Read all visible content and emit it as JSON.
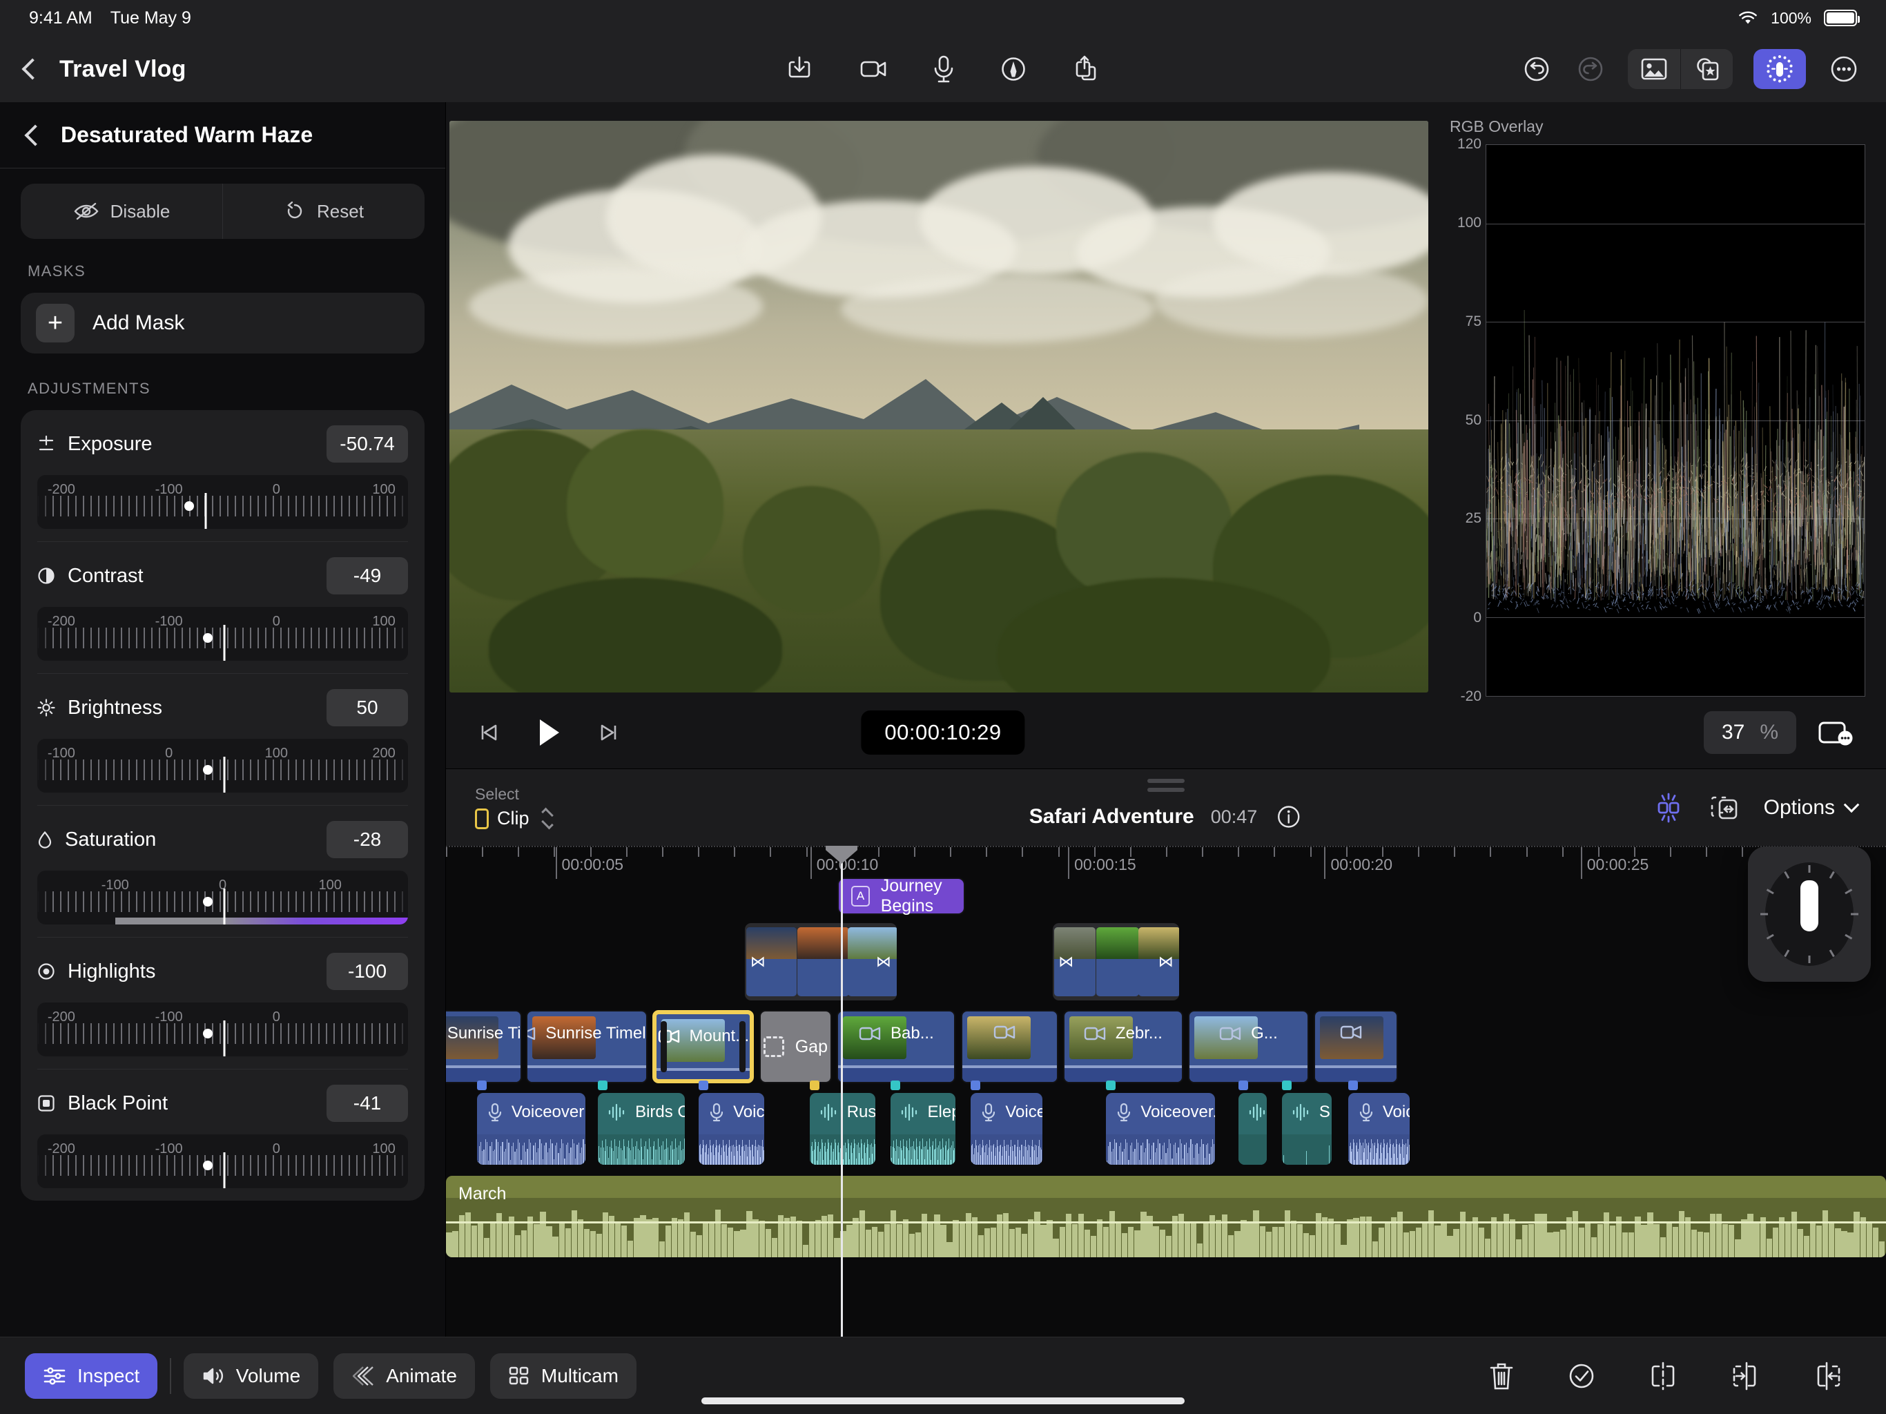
{
  "status_bar": {
    "time": "9:41 AM",
    "date": "Tue May 9",
    "battery": "100%"
  },
  "toolbar": {
    "project_title": "Travel Vlog",
    "back_icon": "chevron-left-icon",
    "center_icons": [
      "import-media-icon",
      "video-camera-icon",
      "microphone-icon",
      "draw-pen-icon",
      "export-share-icon"
    ],
    "undo_icon": "undo-icon",
    "redo_icon": "redo-icon",
    "media_browser_icon": "photo-library-icon",
    "effects_icon": "effects-star-icon",
    "color_icon": "color-grading-icon",
    "more_icon": "more-ellipsis-icon"
  },
  "inspector": {
    "title": "Desaturated Warm Haze",
    "back_icon": "chevron-left-icon",
    "disable_label": "Disable",
    "disable_icon": "eye-slash-icon",
    "reset_label": "Reset",
    "reset_icon": "reset-arrow-icon",
    "masks_section": "MASKS",
    "add_mask_label": "Add Mask",
    "add_mask_icon": "plus-icon",
    "adjustments_section": "ADJUSTMENTS",
    "accent_color": "#7b4ddb",
    "adjustments": [
      {
        "name": "Exposure",
        "icon": "exposure-icon",
        "value": "-50.74",
        "pos": 0.455,
        "ticks": [
          "-200",
          "-100",
          "0",
          "100"
        ],
        "tickpos": [
          0.065,
          0.355,
          0.645,
          0.935
        ],
        "bar": false
      },
      {
        "name": "Contrast",
        "icon": "contrast-icon",
        "value": "-49",
        "pos": 0.505,
        "ticks": [
          "-200",
          "-100",
          "0",
          "100"
        ],
        "tickpos": [
          0.065,
          0.355,
          0.645,
          0.935
        ],
        "bar": false
      },
      {
        "name": "Brightness",
        "icon": "brightness-icon",
        "value": "50",
        "pos": 0.505,
        "ticks": [
          "-100",
          "0",
          "100",
          "200"
        ],
        "tickpos": [
          0.065,
          0.355,
          0.645,
          0.935
        ],
        "bar": false
      },
      {
        "name": "Saturation",
        "icon": "saturation-icon",
        "value": "-28",
        "pos": 0.505,
        "ticks": [
          "-100",
          "0",
          "100"
        ],
        "tickpos": [
          0.21,
          0.5,
          0.79
        ],
        "bar": true
      },
      {
        "name": "Highlights",
        "icon": "highlights-icon",
        "value": "-100",
        "pos": 0.505,
        "ticks": [
          "-200",
          "-100",
          "0"
        ],
        "tickpos": [
          0.065,
          0.355,
          0.645
        ],
        "bar": false
      },
      {
        "name": "Black Point",
        "icon": "blackpoint-icon",
        "value": "-41",
        "pos": 0.505,
        "ticks": [
          "-200",
          "-100",
          "0",
          "100"
        ],
        "tickpos": [
          0.065,
          0.355,
          0.645,
          0.935
        ],
        "bar": false
      }
    ]
  },
  "scope": {
    "title": "RGB Overlay",
    "axis_labels": [
      "120",
      "100",
      "75",
      "50",
      "25",
      "0",
      "-20"
    ],
    "axis_positions": [
      0.0,
      0.143,
      0.321,
      0.5,
      0.678,
      0.857,
      1.0
    ]
  },
  "transport": {
    "skip_back_icon": "skip-to-start-icon",
    "play_icon": "play-icon",
    "skip_fwd_icon": "skip-to-end-icon",
    "timecode": "00:00:10:29",
    "zoom_value": "37",
    "zoom_unit": "%",
    "viewer_options_icon": "viewer-options-icon"
  },
  "timeline_header": {
    "select_label": "Select",
    "mode_label": "Clip",
    "mode_icon": "clip-icon",
    "stepper_icon": "stepper-up-down-icon",
    "grabber_icon": "drag-handle-icon",
    "project_name": "Safari Adventure",
    "duration": "00:47",
    "info_icon": "info-circle-icon",
    "snap_icon": "snapping-icon",
    "fit_icon": "fit-timeline-icon",
    "options_label": "Options",
    "options_chevron": "chevron-down-icon"
  },
  "timeline": {
    "ruler_labels": [
      "00:00:05",
      "00:00:10",
      "00:00:15",
      "00:00:20",
      "00:00:25"
    ],
    "ruler_positions": [
      0.076,
      0.253,
      0.432,
      0.61,
      0.788
    ],
    "playhead_position": 0.274,
    "title_clips": [
      {
        "label": "Journey Begins",
        "badge": "A",
        "left": 0.272,
        "width": 0.0885
      }
    ],
    "overlay_clips": [
      {
        "left": 0.2075,
        "width": 0.1055
      },
      {
        "left": 0.4215,
        "width": 0.0875
      }
    ],
    "video_clips": [
      {
        "label": "Sunrise Ti...",
        "type": "video",
        "left": -0.012,
        "width": 0.0645,
        "selected": false
      },
      {
        "label": "Sunrise Timel...",
        "type": "video",
        "left": 0.0555,
        "width": 0.0845,
        "selected": false
      },
      {
        "label": "Mount...",
        "type": "video",
        "left": 0.1435,
        "width": 0.0705,
        "selected": true
      },
      {
        "label": "Gap",
        "type": "gap",
        "left": 0.2175,
        "width": 0.0505,
        "selected": false
      },
      {
        "label": "Bab...",
        "type": "video",
        "left": 0.2715,
        "width": 0.0825,
        "selected": false
      },
      {
        "label": "",
        "type": "video",
        "left": 0.3575,
        "width": 0.0675,
        "selected": false
      },
      {
        "label": "Zebr...",
        "type": "video",
        "left": 0.4285,
        "width": 0.0835,
        "selected": false
      },
      {
        "label": "G...",
        "type": "video",
        "left": 0.5155,
        "width": 0.0835,
        "selected": false
      },
      {
        "label": "",
        "type": "video",
        "left": 0.6025,
        "width": 0.0585,
        "selected": false
      }
    ],
    "audio_clips": [
      {
        "label": "Voiceover T...",
        "kind": "voiceover",
        "left": 0.0215,
        "width": 0.0755
      },
      {
        "label": "Birds C...",
        "kind": "sfx",
        "left": 0.1055,
        "width": 0.0605
      },
      {
        "label": "Voic...",
        "kind": "voiceover",
        "left": 0.1755,
        "width": 0.0455
      },
      {
        "label": "Rustl...",
        "kind": "sfx",
        "left": 0.2525,
        "width": 0.0455
      },
      {
        "label": "Elep...",
        "kind": "sfx",
        "left": 0.3085,
        "width": 0.0455
      },
      {
        "label": "Voice...",
        "kind": "voiceover",
        "left": 0.3645,
        "width": 0.0495
      },
      {
        "label": "Voiceover...",
        "kind": "voiceover",
        "left": 0.4585,
        "width": 0.0755
      },
      {
        "label": "",
        "kind": "sfx",
        "left": 0.5505,
        "width": 0.0195
      },
      {
        "label": "S",
        "kind": "sfx",
        "left": 0.5805,
        "width": 0.0345
      },
      {
        "label": "Voice...",
        "kind": "voiceover",
        "left": 0.6265,
        "width": 0.0425
      }
    ],
    "music_clip": {
      "label": "March"
    },
    "color_wheel_icon": "color-wheel-widget"
  },
  "bottom_bar": {
    "tools": [
      {
        "label": "Inspect",
        "icon": "sliders-icon",
        "active": true
      },
      {
        "label": "Volume",
        "icon": "speaker-icon",
        "active": false
      },
      {
        "label": "Animate",
        "icon": "animate-icon",
        "active": false
      },
      {
        "label": "Multicam",
        "icon": "multicam-icon",
        "active": false
      }
    ],
    "actions": [
      "trash-icon",
      "check-circle-icon",
      "split-clip-icon",
      "trim-start-icon",
      "trim-end-icon"
    ]
  }
}
